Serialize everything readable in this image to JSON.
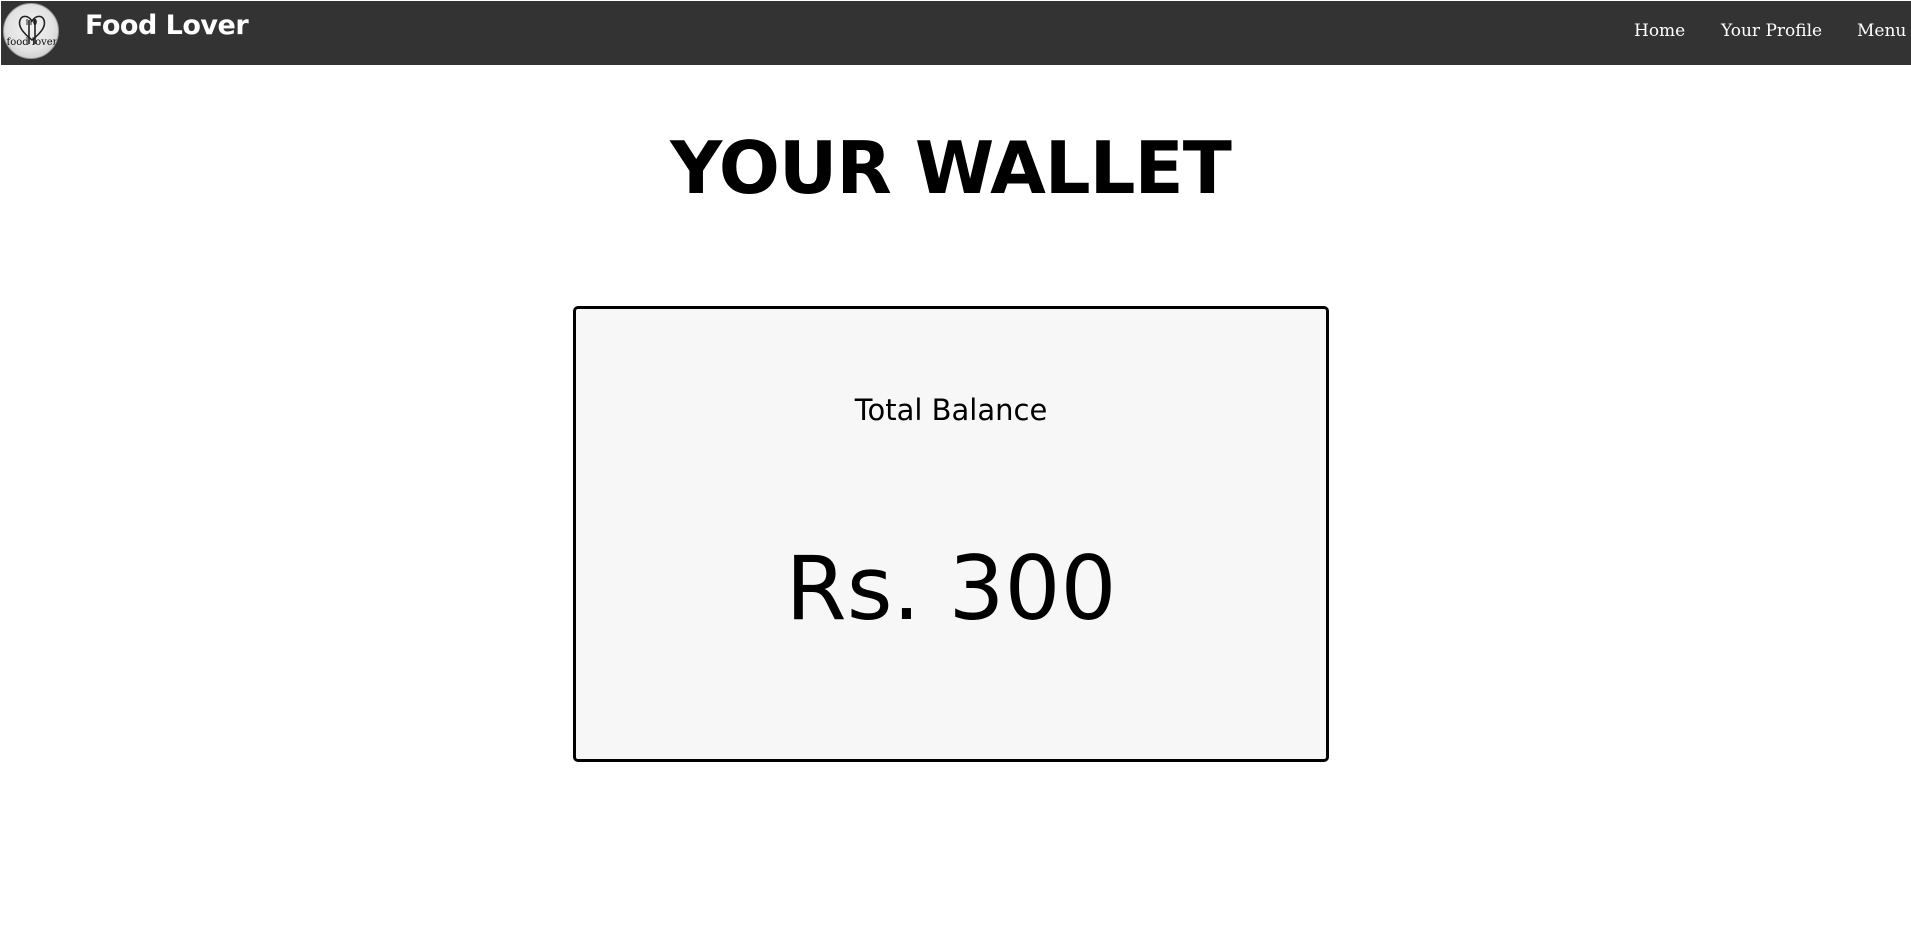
{
  "navbar": {
    "logo_text": "food lover",
    "brand": "Food Lover",
    "links": [
      {
        "label": "Home"
      },
      {
        "label": "Your Profile"
      },
      {
        "label": "Menu"
      }
    ],
    "background_color": "#333333"
  },
  "main": {
    "title": "YOUR WALLET",
    "card": {
      "label": "Total Balance",
      "amount": "Rs. 300",
      "background_color": "#f7f7f7",
      "border_color": "#000000"
    }
  }
}
